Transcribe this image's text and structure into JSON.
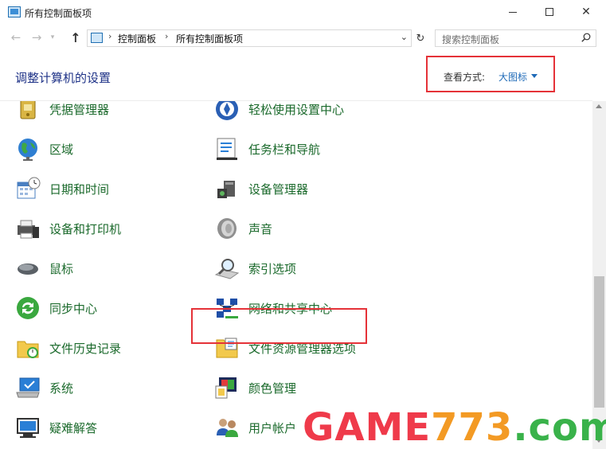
{
  "window": {
    "title": "所有控制面板项",
    "controls": {
      "minimize": "minimize-icon",
      "maximize": "maximize-icon",
      "close": "close-icon"
    }
  },
  "navigation": {
    "back_icon": "arrow-left-icon",
    "forward_icon": "arrow-right-icon",
    "up_icon": "arrow-up-icon",
    "breadcrumb": [
      "控制面板",
      "所有控制面板项"
    ],
    "search_placeholder": "搜索控制面板"
  },
  "header": {
    "title": "调整计算机的设置",
    "view_by_label": "查看方式:",
    "view_by_value": "大图标"
  },
  "items": [
    {
      "label": "凭据管理器",
      "icon": "credential-manager-icon"
    },
    {
      "label": "轻松使用设置中心",
      "icon": "ease-of-access-icon"
    },
    {
      "label": "区域",
      "icon": "region-globe-icon"
    },
    {
      "label": "任务栏和导航",
      "icon": "taskbar-icon"
    },
    {
      "label": "日期和时间",
      "icon": "date-time-icon"
    },
    {
      "label": "设备管理器",
      "icon": "device-manager-icon"
    },
    {
      "label": "设备和打印机",
      "icon": "printer-icon"
    },
    {
      "label": "声音",
      "icon": "speaker-icon"
    },
    {
      "label": "鼠标",
      "icon": "mouse-icon"
    },
    {
      "label": "索引选项",
      "icon": "indexing-icon"
    },
    {
      "label": "同步中心",
      "icon": "sync-icon"
    },
    {
      "label": "网络和共享中心",
      "icon": "network-icon"
    },
    {
      "label": "文件历史记录",
      "icon": "file-history-icon"
    },
    {
      "label": "文件资源管理器选项",
      "icon": "folder-options-icon"
    },
    {
      "label": "系统",
      "icon": "system-monitor-icon"
    },
    {
      "label": "颜色管理",
      "icon": "color-management-icon"
    },
    {
      "label": "疑难解答",
      "icon": "troubleshooting-icon"
    },
    {
      "label": "用户帐户",
      "icon": "user-accounts-icon"
    }
  ],
  "watermark": {
    "part1": "GAME",
    "part2": "773",
    "part3": ".com"
  },
  "colors": {
    "link_green": "#1b6a2c",
    "heading_blue": "#1e3287",
    "highlight_red": "#e53238"
  }
}
